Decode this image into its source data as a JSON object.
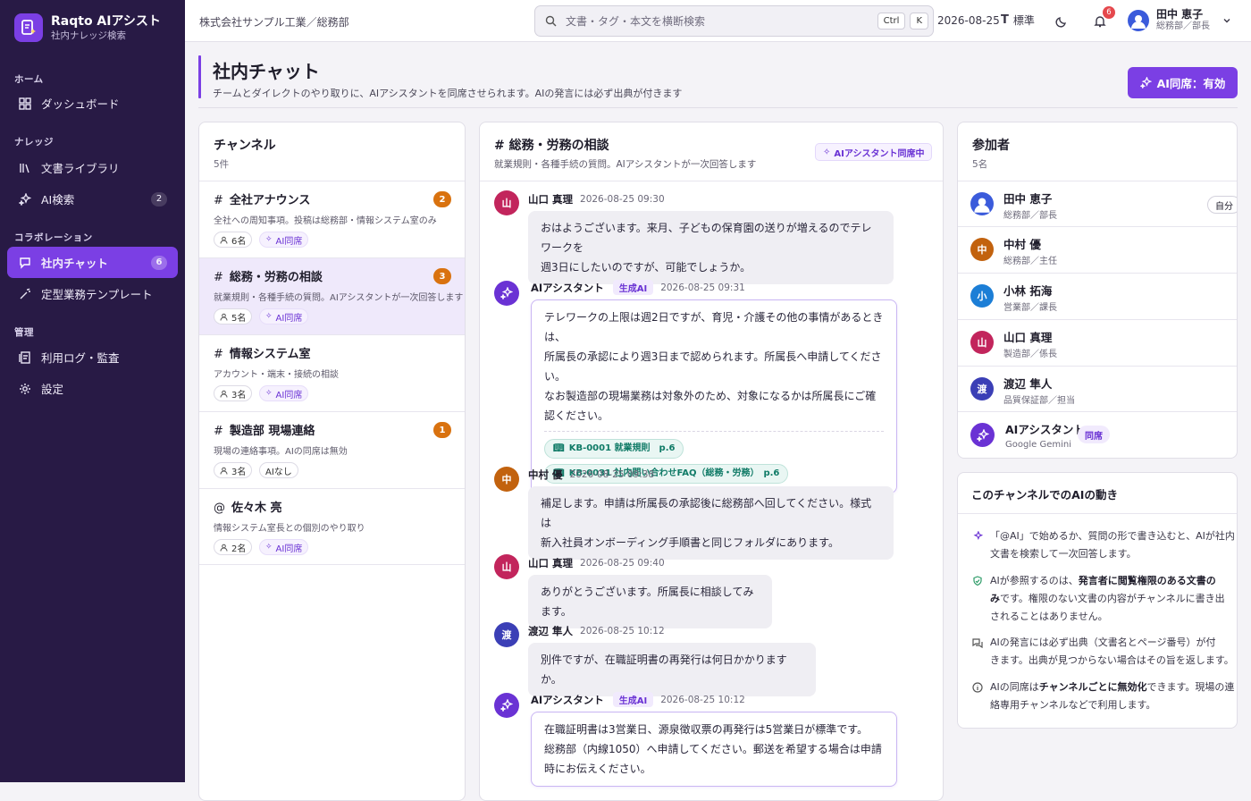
{
  "brand": {
    "name": "Raqto AIアシスト",
    "sub": "社内ナレッジ検索"
  },
  "nav": {
    "sections": [
      "ホーム",
      "ナレッジ",
      "コラボレーション",
      "管理"
    ],
    "items": [
      {
        "label": "ダッシュボード",
        "icon": "dashboard-icon"
      },
      {
        "label": "文書ライブラリ",
        "icon": "library-icon"
      },
      {
        "label": "AI検索",
        "icon": "sparkle-icon",
        "badge": "2"
      },
      {
        "label": "社内チャット",
        "icon": "chat-icon",
        "badge": "6",
        "active": true
      },
      {
        "label": "定型業務テンプレート",
        "icon": "wand-icon"
      },
      {
        "label": "利用ログ・監査",
        "icon": "log-icon"
      },
      {
        "label": "設定",
        "icon": "gear-icon"
      }
    ]
  },
  "topbar": {
    "org": "株式会社サンプル工業／総務部",
    "search_placeholder": "文書・タグ・本文を横断検索",
    "kbd1": "Ctrl",
    "kbd2": "K",
    "date": "2026-08-25",
    "font_label": "標準",
    "notif_count": "6",
    "user_name": "田中 恵子",
    "user_role": "総務部／部長"
  },
  "page": {
    "title": "社内チャット",
    "desc": "チームとダイレクトのやり取りに、AIアシスタントを同席させられます。AIの発言には必ず出典が付きます",
    "ai_button": "AI同席：有効"
  },
  "channels": {
    "title": "チャンネル",
    "count": "5件",
    "items": [
      {
        "prefix": "#",
        "name": "全社アナウンス",
        "desc": "全社への周知事項。投稿は総務部・情報システム室のみ",
        "badge": "2",
        "members": "6名",
        "ai": "AI同席"
      },
      {
        "prefix": "#",
        "name": "総務・労務の相談",
        "desc": "就業規則・各種手続の質問。AIアシスタントが一次回答します",
        "badge": "3",
        "members": "5名",
        "ai": "AI同席"
      },
      {
        "prefix": "#",
        "name": "情報システム室",
        "desc": "アカウント・端末・接続の相談",
        "badge": "",
        "members": "3名",
        "ai": "AI同席"
      },
      {
        "prefix": "#",
        "name": "製造部 現場連絡",
        "desc": "現場の連絡事項。AIの同席は無効",
        "badge": "1",
        "members": "3名",
        "ai": "AIなし"
      },
      {
        "prefix": "@",
        "name": "佐々木 亮",
        "desc": "情報システム室長との個別のやり取り",
        "badge": "",
        "members": "2名",
        "ai": "AI同席"
      }
    ]
  },
  "chat": {
    "title": "# 総務・労務の相談",
    "desc": "就業規則・各種手続の質問。AIアシスタントが一次回答します",
    "ai_status": "AIアシスタント同席中",
    "messages": [
      {
        "avatar": "山",
        "name": "山口 真理",
        "time": "2026-08-25 09:30",
        "lines": [
          "おはようございます。来月、子どもの保育園の送りが増えるのでテレワークを",
          "週3日にしたいのですが、可能でしょうか。"
        ]
      },
      {
        "avatar": "AI",
        "name": "AIアシスタント",
        "tag": "生成AI",
        "time": "2026-08-25 09:31",
        "lines": [
          "テレワークの上限は週2日ですが、育児・介護その他の事情があるときは、",
          "所属長の承認により週3日まで認められます。所属長へ申請してください。",
          "なお製造部の現場業務は対象外のため、対象になるかは所属長にご確",
          "認ください。"
        ],
        "sources": [
          "KB-0001 就業規則　p.6",
          "KB-0031 社内問い合わせFAQ（総務・労務）　p.6"
        ]
      },
      {
        "avatar": "中",
        "name": "中村 優",
        "time": "2026-08-25 09:38",
        "lines": [
          "補足します。申請は所属長の承認後に総務部へ回してください。様式は",
          "新入社員オンボーディング手順書と同じフォルダにあります。"
        ]
      },
      {
        "avatar": "山",
        "name": "山口 真理",
        "time": "2026-08-25 09:40",
        "lines": [
          "ありがとうございます。所属長に相談してみます。"
        ]
      },
      {
        "avatar": "渡",
        "name": "渡辺 隼人",
        "time": "2026-08-25 10:12",
        "lines": [
          "別件ですが、在職証明書の再発行は何日かかりますか。"
        ]
      },
      {
        "avatar": "AI",
        "name": "AIアシスタント",
        "tag": "生成AI",
        "time": "2026-08-25 10:12",
        "lines": [
          "在職証明書は3営業日、源泉徴収票の再発行は5営業日が標準です。",
          "総務部（内線1050）へ申請してください。郵送を希望する場合は申請",
          "時にお伝えください。"
        ]
      }
    ]
  },
  "participants": {
    "title": "参加者",
    "count": "5名",
    "items": [
      {
        "avatar": "",
        "name": "田中 恵子",
        "role": "総務部／部長",
        "tag": "自分"
      },
      {
        "avatar": "中",
        "name": "中村 優",
        "role": "総務部／主任"
      },
      {
        "avatar": "小",
        "name": "小林 拓海",
        "role": "営業部／課長"
      },
      {
        "avatar": "山",
        "name": "山口 真理",
        "role": "製造部／係長"
      },
      {
        "avatar": "渡",
        "name": "渡辺 隼人",
        "role": "品質保証部／担当"
      },
      {
        "avatar": "AI",
        "name": "AIアシスタント",
        "role": "Google Gemini",
        "tag": "同席"
      }
    ]
  },
  "ai_behavior": {
    "title": "このチャンネルでのAIの動き",
    "r1": [
      "「@AI」で始めるか、質問の形で書き込むと、AIが社内",
      "文書を検索して一次回答します。"
    ],
    "r2a": "AIが参照するのは、",
    "r2b": "発言者に閲覧権限のある文書の",
    "r2c": "み",
    "r2d": "です。権限のない文書の内容がチャンネルに書き出",
    "r2e": "されることはありません。",
    "r3": [
      "AIの発言には必ず出典（文書名とページ番号）が付",
      "きます。出典が見つからない場合はその旨を返します。"
    ],
    "r4a": "AIの同席は",
    "r4b": "チャンネルごとに無効化",
    "r4c": "できます。現場の連",
    "r4d": "絡専用チャンネルなどで利用します。"
  },
  "colors": {
    "accent": "#7b3fe4",
    "sidebar": "#281a45",
    "badge": "#d9720f",
    "source": "#0f7a66"
  }
}
